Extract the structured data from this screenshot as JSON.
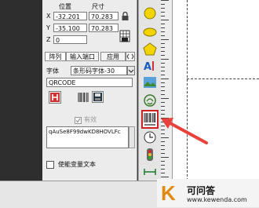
{
  "position_panel": {
    "heading_position": "位置",
    "heading_size": "尺寸",
    "x_label": "X",
    "y_label": "Y",
    "z_label": "Z",
    "x_value": "-32.201",
    "y_value": "-35.100",
    "z_value": "0",
    "width_value": "70.283",
    "height_value": "70.283"
  },
  "tabs": [
    {
      "label": "阵列"
    },
    {
      "label": "输入端口"
    },
    {
      "label": "应用"
    }
  ],
  "font_row": {
    "label": "字体",
    "value": "条形码字体-30"
  },
  "barcode_type": "QRCODE",
  "valid_label": "有效",
  "data_text": "qAuSe8F99dwKD8HOVLFc",
  "variable_text_label": "使能变量文本",
  "watermark": {
    "letter": "K",
    "title": "可问答",
    "url": "www.kewenda.com"
  },
  "colors": {
    "highlight_arrow": "#e8423c",
    "accent_red": "#cc2222"
  }
}
